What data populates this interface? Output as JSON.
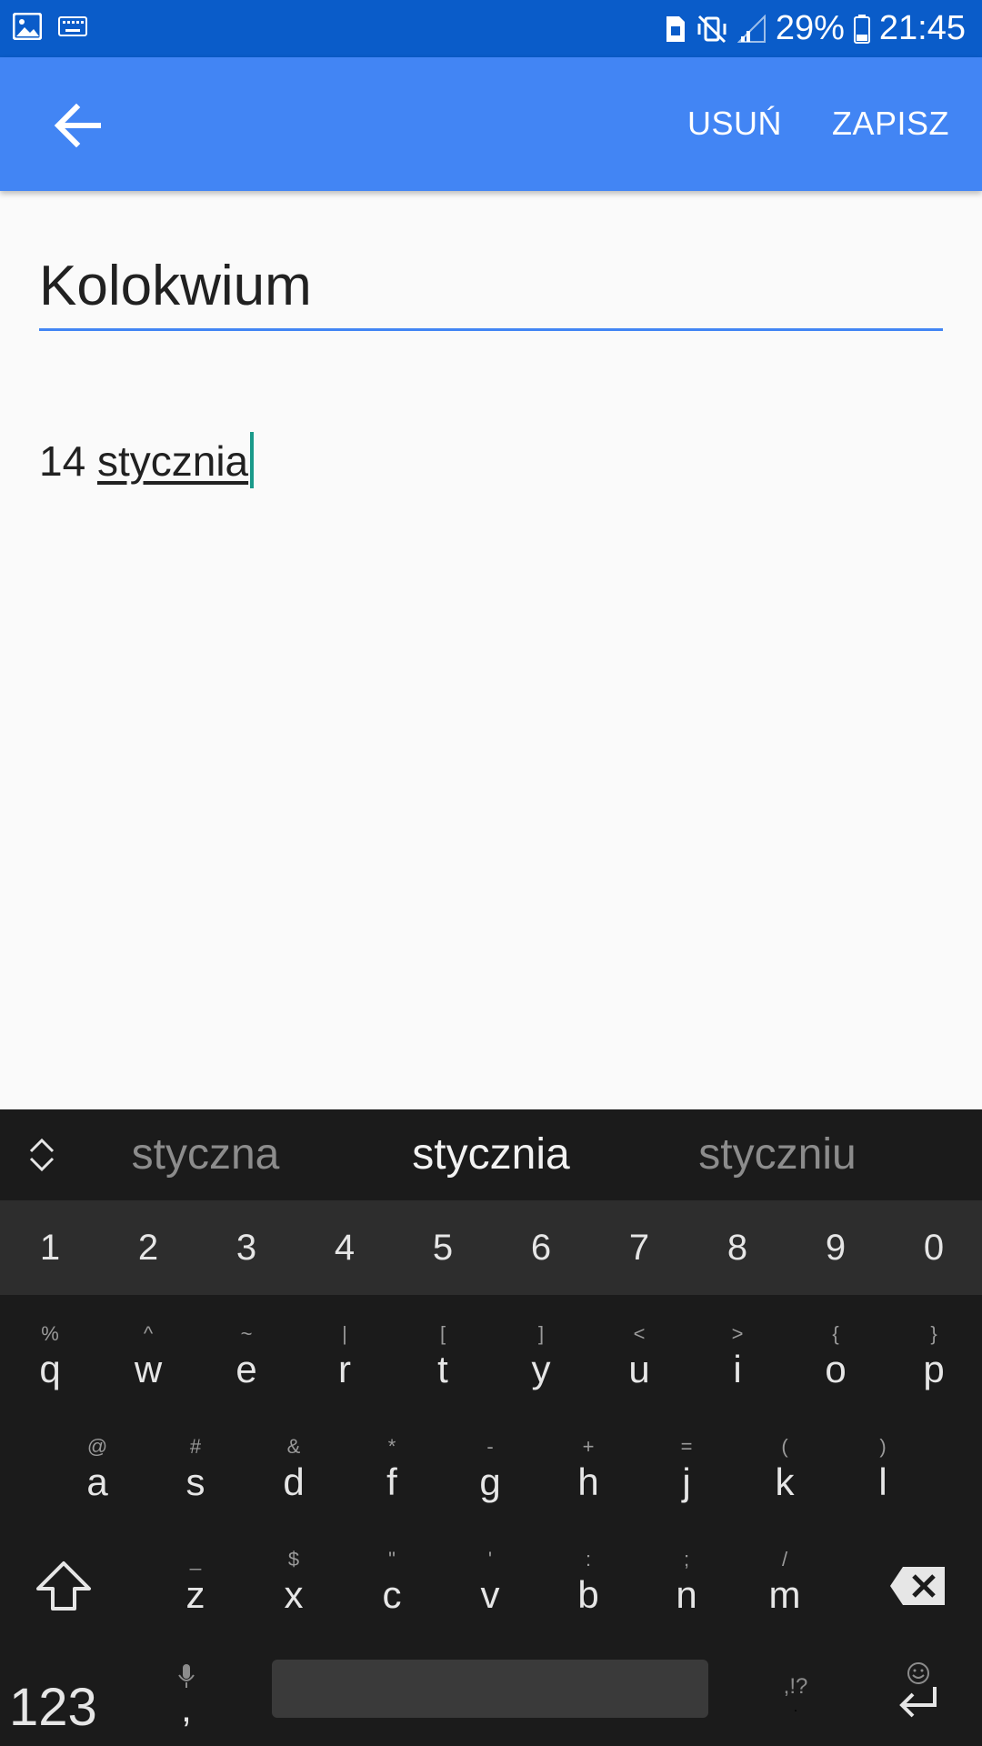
{
  "status_bar": {
    "battery_percent": "29%",
    "time": "21:45"
  },
  "app_bar": {
    "delete_label": "USUŃ",
    "save_label": "ZAPISZ"
  },
  "note": {
    "title": "Kolokwium",
    "body_prefix": "14 ",
    "body_composing": "stycznia"
  },
  "keyboard": {
    "suggestions": [
      "styczna",
      "stycznia",
      "styczniu"
    ],
    "numbers": [
      "1",
      "2",
      "3",
      "4",
      "5",
      "6",
      "7",
      "8",
      "9",
      "0"
    ],
    "row1": [
      {
        "hint": "%",
        "key": "q"
      },
      {
        "hint": "^",
        "key": "w"
      },
      {
        "hint": "~",
        "key": "e"
      },
      {
        "hint": "|",
        "key": "r"
      },
      {
        "hint": "[",
        "key": "t"
      },
      {
        "hint": "]",
        "key": "y"
      },
      {
        "hint": "<",
        "key": "u"
      },
      {
        "hint": ">",
        "key": "i"
      },
      {
        "hint": "{",
        "key": "o"
      },
      {
        "hint": "}",
        "key": "p"
      }
    ],
    "row2": [
      {
        "hint": "@",
        "key": "a"
      },
      {
        "hint": "#",
        "key": "s"
      },
      {
        "hint": "&",
        "key": "d"
      },
      {
        "hint": "*",
        "key": "f"
      },
      {
        "hint": "-",
        "key": "g"
      },
      {
        "hint": "+",
        "key": "h"
      },
      {
        "hint": "=",
        "key": "j"
      },
      {
        "hint": "(",
        "key": "k"
      },
      {
        "hint": ")",
        "key": "l"
      }
    ],
    "row3": [
      {
        "hint": "_",
        "key": "z"
      },
      {
        "hint": "$",
        "key": "x"
      },
      {
        "hint": "\"",
        "key": "c"
      },
      {
        "hint": "'",
        "key": "v"
      },
      {
        "hint": ":",
        "key": "b"
      },
      {
        "hint": ";",
        "key": "n"
      },
      {
        "hint": "/",
        "key": "m"
      }
    ],
    "symbols_label": "123",
    "comma_label": ",",
    "period_label": ".",
    "period_hint": ",!?"
  }
}
